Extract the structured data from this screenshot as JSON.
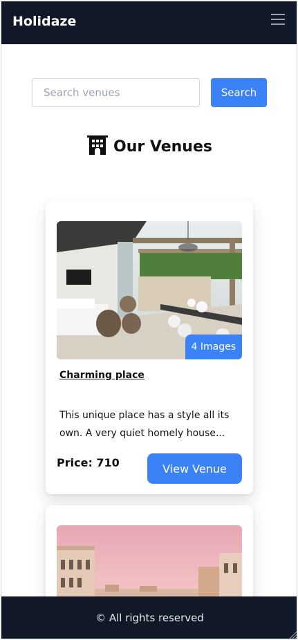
{
  "header": {
    "brand": "Holidaze",
    "menu_icon": "hamburger-icon"
  },
  "search": {
    "placeholder": "Search venues",
    "value": "",
    "button_label": "Search"
  },
  "page": {
    "title": "Our Venues",
    "title_icon": "building-icon"
  },
  "venues": [
    {
      "name": "Charming place",
      "image_badge": "4 Images",
      "description": "This unique place has a style all its own. A very quiet homely house...",
      "price_label": "Price: 710",
      "button_label": "View Venue"
    },
    {
      "name": "",
      "image_badge": "",
      "description": "",
      "price_label": "",
      "button_label": ""
    }
  ],
  "footer": {
    "text": "© All rights reserved"
  },
  "colors": {
    "header_bg": "#111827",
    "accent": "#3b82f6",
    "footer_bg": "#111827"
  }
}
